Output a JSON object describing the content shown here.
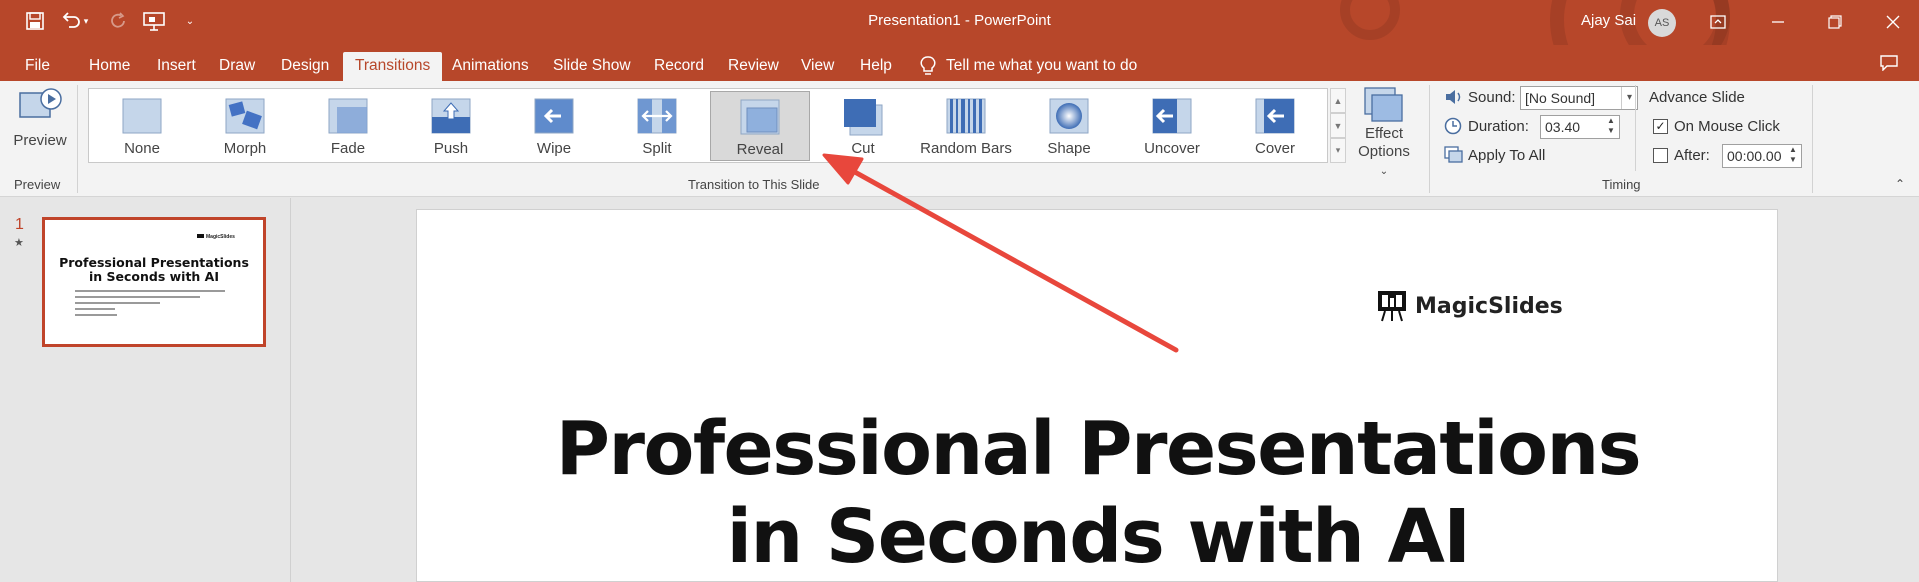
{
  "app": {
    "document_title": "Presentation1",
    "separator": "-",
    "app_name": "PowerPoint",
    "user_name": "Ajay Sai",
    "user_initials": "AS"
  },
  "quick_access": {
    "icons": [
      "save-icon",
      "undo-icon",
      "redo-icon",
      "present-from-start-icon",
      "customize-qat-icon"
    ]
  },
  "tabs": [
    {
      "label": "File"
    },
    {
      "label": "Home"
    },
    {
      "label": "Insert"
    },
    {
      "label": "Draw"
    },
    {
      "label": "Design"
    },
    {
      "label": "Transitions",
      "active": true
    },
    {
      "label": "Animations"
    },
    {
      "label": "Slide Show"
    },
    {
      "label": "Record"
    },
    {
      "label": "Review"
    },
    {
      "label": "View"
    },
    {
      "label": "Help"
    }
  ],
  "tell_me": "Tell me what you want to do",
  "ribbon": {
    "preview_label": "Preview",
    "preview_group": "Preview",
    "transition_group": "Transition to This Slide",
    "transitions": [
      {
        "label": "None"
      },
      {
        "label": "Morph"
      },
      {
        "label": "Fade"
      },
      {
        "label": "Push"
      },
      {
        "label": "Wipe"
      },
      {
        "label": "Split"
      },
      {
        "label": "Reveal",
        "selected": true
      },
      {
        "label": "Cut"
      },
      {
        "label": "Random Bars"
      },
      {
        "label": "Shape"
      },
      {
        "label": "Uncover"
      },
      {
        "label": "Cover"
      }
    ],
    "effect_options": [
      "Effect",
      "Options"
    ],
    "timing": {
      "sound_label": "Sound:",
      "sound_value": "[No Sound]",
      "duration_label": "Duration:",
      "duration_value": "03.40",
      "apply_all": "Apply To All",
      "advance_title": "Advance Slide",
      "on_mouse_click": "On Mouse Click",
      "on_mouse_click_checked": true,
      "after_label": "After:",
      "after_value": "00:00.00",
      "after_checked": false,
      "group_label": "Timing"
    }
  },
  "slides_pane": {
    "slide_number": "1",
    "thumb_brand": "MagicSlides",
    "thumb_title_line1": "Professional Presentations",
    "thumb_title_line2": "in Seconds with AI"
  },
  "slide": {
    "brand": "MagicSlides",
    "title_line1": "Professional Presentations",
    "title_line2": "in Seconds with AI"
  },
  "colors": {
    "accent": "#b7472a",
    "arrow": "#e8473c"
  }
}
